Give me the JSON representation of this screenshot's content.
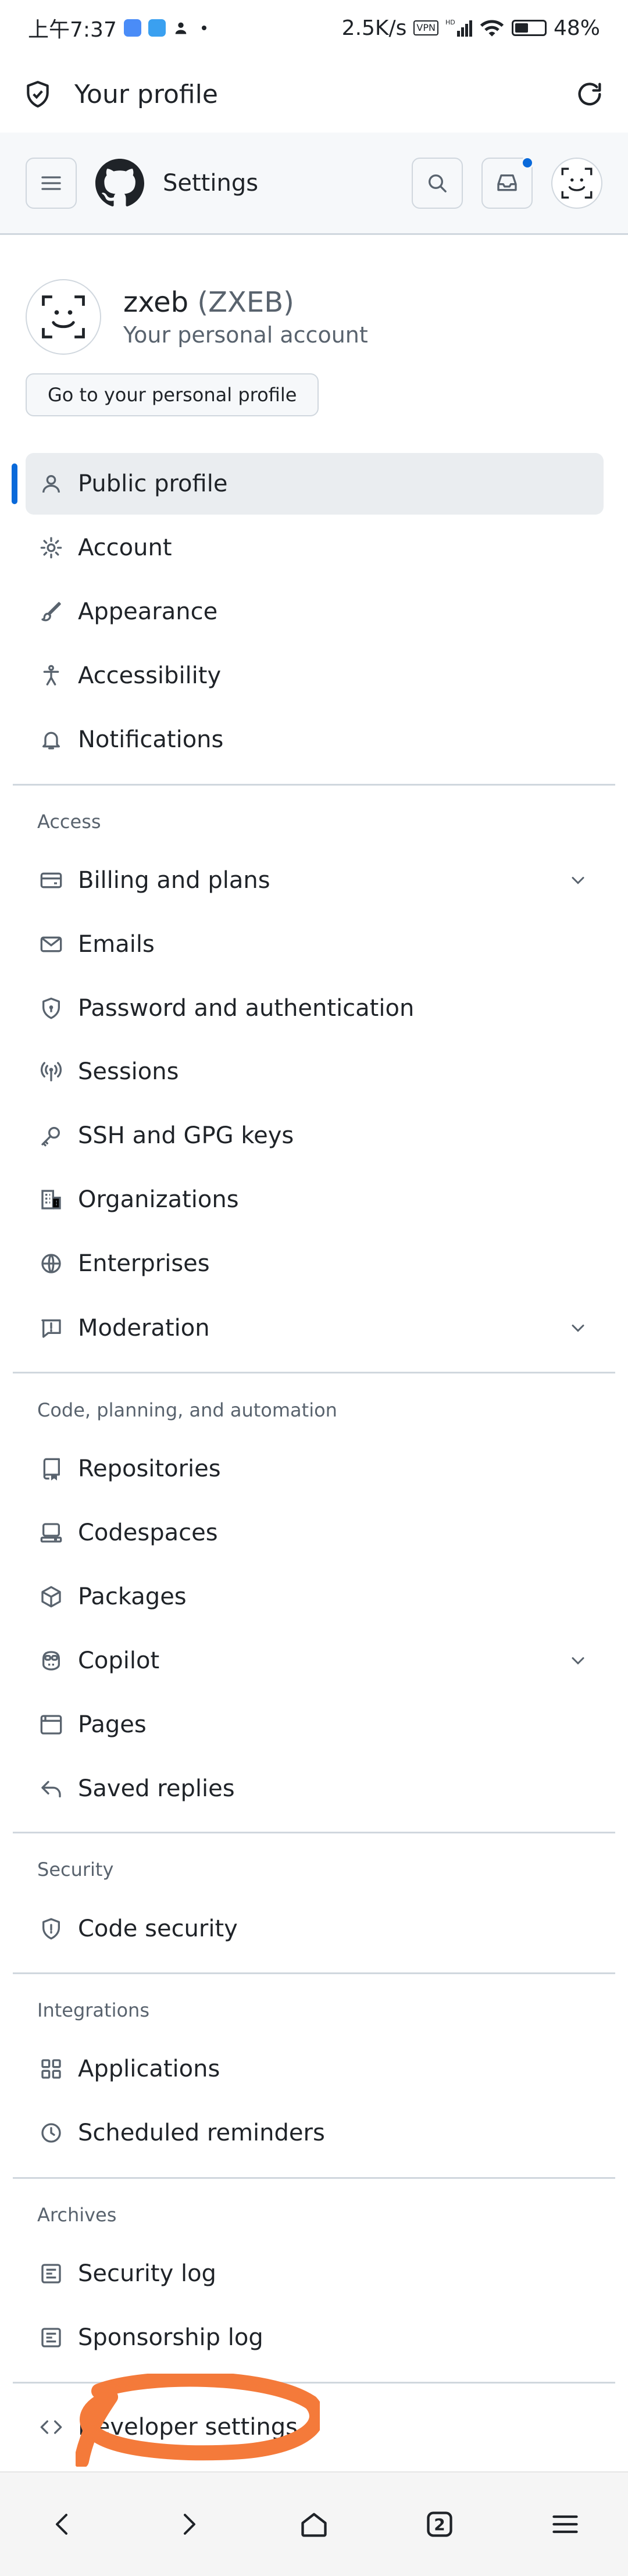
{
  "status_bar": {
    "time": "上午7:37",
    "net_speed": "2.5K/s",
    "vpn": "VPN",
    "hd": "HD",
    "battery": "48%"
  },
  "app_bar": {
    "title": "Your profile"
  },
  "header": {
    "page_label": "Settings"
  },
  "profile": {
    "login": "zxeb",
    "handle": "(ZXEB)",
    "subtitle": "Your personal account",
    "goto_button": "Go to your personal profile"
  },
  "nav": {
    "primary": [
      {
        "label": "Public profile",
        "icon": "person-icon",
        "active": true
      },
      {
        "label": "Account",
        "icon": "gear-icon"
      },
      {
        "label": "Appearance",
        "icon": "paintbrush-icon"
      },
      {
        "label": "Accessibility",
        "icon": "accessibility-icon"
      },
      {
        "label": "Notifications",
        "icon": "bell-icon"
      }
    ],
    "access_label": "Access",
    "access": [
      {
        "label": "Billing and plans",
        "icon": "credit-card-icon",
        "expandable": true
      },
      {
        "label": "Emails",
        "icon": "mail-icon"
      },
      {
        "label": "Password and authentication",
        "icon": "shield-lock-icon"
      },
      {
        "label": "Sessions",
        "icon": "broadcast-icon"
      },
      {
        "label": "SSH and GPG keys",
        "icon": "key-icon"
      },
      {
        "label": "Organizations",
        "icon": "organization-icon"
      },
      {
        "label": "Enterprises",
        "icon": "globe-icon"
      },
      {
        "label": "Moderation",
        "icon": "report-icon",
        "expandable": true
      }
    ],
    "code_label": "Code, planning, and automation",
    "code": [
      {
        "label": "Repositories",
        "icon": "repo-icon"
      },
      {
        "label": "Codespaces",
        "icon": "codespaces-icon"
      },
      {
        "label": "Packages",
        "icon": "package-icon"
      },
      {
        "label": "Copilot",
        "icon": "copilot-icon",
        "expandable": true
      },
      {
        "label": "Pages",
        "icon": "browser-icon"
      },
      {
        "label": "Saved replies",
        "icon": "reply-icon"
      }
    ],
    "security_label": "Security",
    "security": [
      {
        "label": "Code security",
        "icon": "shield-icon"
      }
    ],
    "integrations_label": "Integrations",
    "integrations": [
      {
        "label": "Applications",
        "icon": "apps-icon"
      },
      {
        "label": "Scheduled reminders",
        "icon": "clock-icon"
      }
    ],
    "archives_label": "Archives",
    "archives": [
      {
        "label": "Security log",
        "icon": "log-icon"
      },
      {
        "label": "Sponsorship log",
        "icon": "log-icon"
      }
    ],
    "developer": {
      "label": "Developer settings",
      "icon": "code-icon"
    }
  },
  "colors": {
    "accent": "#0969da",
    "text": "#1f2328",
    "muted": "#59636e",
    "border": "#d0d7de",
    "annotation": "#f47a3a"
  },
  "bottom_bar": {
    "tab_count": "2"
  }
}
